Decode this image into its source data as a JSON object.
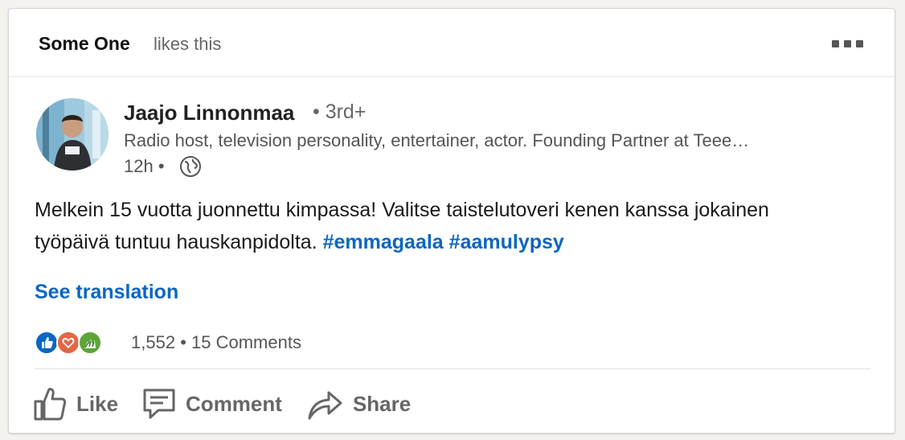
{
  "activity": {
    "actor": "Some One",
    "action": "likes this",
    "more_icon": "more-horizontal-icon"
  },
  "author": {
    "name": "Jaajo Linnonmaa",
    "degree": "• 3rd+",
    "headline": "Radio host, television personality, entertainer, actor. Founding Partner at Teee…",
    "time": "12h •",
    "visibility_icon": "globe-icon"
  },
  "post": {
    "text": "Melkein 15 vuotta juonnettu kimpassa! Valitse taistelutoveri kenen kanssa jokainen työpäivä tuntuu hauskanpidolta.",
    "hashtags": [
      "#emmagaala",
      "#aamulypsy"
    ],
    "see_translation": "See translation"
  },
  "social": {
    "reaction_icons": [
      "like-reaction-icon",
      "love-reaction-icon",
      "celebrate-reaction-icon"
    ],
    "reaction_count": "1,552",
    "separator": "•",
    "comments": "15 Comments"
  },
  "actions": {
    "like": "Like",
    "comment": "Comment",
    "share": "Share"
  },
  "colors": {
    "link": "#0a66c2",
    "like_reaction": "#0a66c2",
    "love_reaction": "#e06847",
    "celebrate_reaction": "#5ca538"
  }
}
